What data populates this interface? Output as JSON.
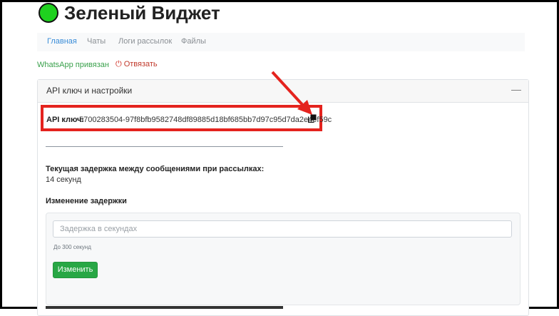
{
  "header": {
    "title": "Зеленый Виджет",
    "logo_color": "#1fd11f"
  },
  "nav": {
    "items": [
      "Главная",
      "Чаты",
      "Логи рассылок",
      "Файлы"
    ],
    "active_index": 0
  },
  "status": {
    "whatsapp_linked": "WhatsApp привязан",
    "unbind_label": "Отвязать"
  },
  "card": {
    "title": "API ключ и настройки",
    "collapse_symbol": "—",
    "api_label": "API ключ",
    "api_key": "5700283504-97f8bfb9582748df89885d18bf685bb7d97c95d7da2e4ef59c",
    "delay_heading": "Текущая задержка между сообщениями при рассылках:",
    "delay_value": "14 секунд",
    "change_heading": "Изменение задержки",
    "input_placeholder": "Задержка в секундах",
    "input_hint": "До 300 секунд",
    "submit_label": "Изменить"
  },
  "colors": {
    "accent_green": "#28a745",
    "danger": "#c0392b",
    "annotation": "#e4231e",
    "link": "#3a8dd8"
  }
}
